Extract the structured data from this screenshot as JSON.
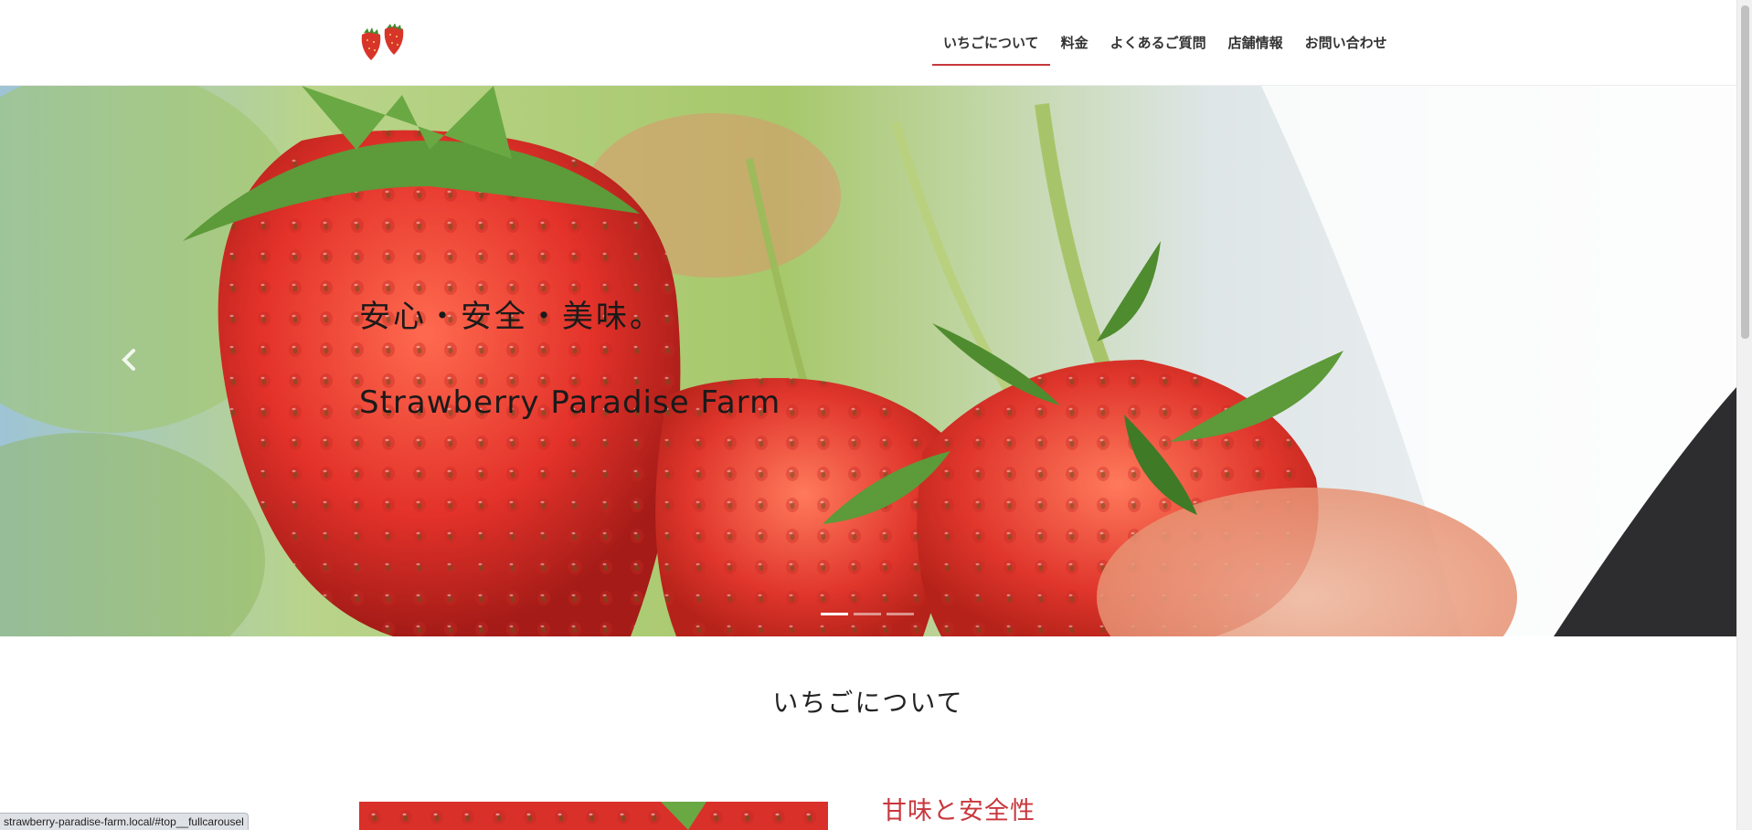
{
  "nav": {
    "items": [
      {
        "label": "いちごについて",
        "active": true
      },
      {
        "label": "料金",
        "active": false
      },
      {
        "label": "よくあるご質問",
        "active": false
      },
      {
        "label": "店舗情報",
        "active": false
      },
      {
        "label": "お問い合わせ",
        "active": false
      }
    ]
  },
  "hero": {
    "tagline": "安心・安全・美味。",
    "title": "Strawberry Paradise Farm",
    "slides_count": 3,
    "active_slide": 1
  },
  "about": {
    "section_title": "いちごについて",
    "subheading": "甘味と安全性"
  },
  "status_bar": {
    "url": "strawberry-paradise-farm.local/#top__fullcarousel"
  },
  "colors": {
    "accent": "#c8373c",
    "strawberry": "#e0362c"
  },
  "icons": {
    "logo": "strawberries-logo-icon",
    "prev": "chevron-left-icon"
  }
}
